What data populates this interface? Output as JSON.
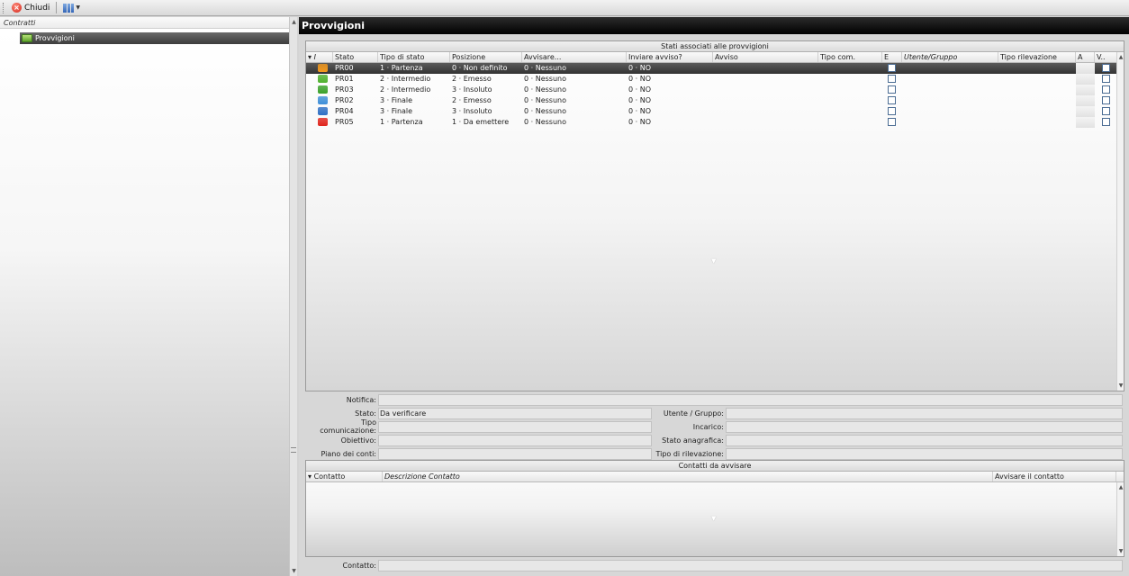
{
  "toolbar": {
    "close_label": "Chiudi"
  },
  "left": {
    "header": "Contratti",
    "tree_item": "Provvigioni"
  },
  "right": {
    "title": "Provvigioni"
  },
  "grid": {
    "title": "Stati associati alle provvigioni",
    "headers": {
      "indicator": "I",
      "stato": "Stato",
      "tipo_stato": "Tipo di stato",
      "posizione": "Posizione",
      "avvisare": "Avvisare...",
      "inviare": "Inviare avviso?",
      "avviso": "Avviso",
      "tipo_com": "Tipo com.",
      "e": "E",
      "utente": "Utente/Gruppo",
      "tipo_ril": "Tipo rilevazione",
      "a": "A",
      "v": "V.."
    },
    "rows": [
      {
        "color": "#f59a1e",
        "stato": "PR00",
        "tipo": "1 · Partenza",
        "posizione": "0 · Non definito",
        "avvisare": "0 · Nessuno",
        "inviare": "0 · NO"
      },
      {
        "color": "#4fb12e",
        "stato": "PR01",
        "tipo": "2 · Intermedio",
        "posizione": "2 · Emesso",
        "avvisare": "0 · Nessuno",
        "inviare": "0 · NO"
      },
      {
        "color": "#3aa12a",
        "stato": "PR03",
        "tipo": "2 · Intermedio",
        "posizione": "3 · Insoluto",
        "avvisare": "0 · Nessuno",
        "inviare": "0 · NO"
      },
      {
        "color": "#3f8fd8",
        "stato": "PR02",
        "tipo": "3 · Finale",
        "posizione": "2 · Emesso",
        "avvisare": "0 · Nessuno",
        "inviare": "0 · NO"
      },
      {
        "color": "#2f6fc4",
        "stato": "PR04",
        "tipo": "3 · Finale",
        "posizione": "3 · Insoluto",
        "avvisare": "0 · Nessuno",
        "inviare": "0 · NO"
      },
      {
        "color": "#e0251d",
        "stato": "PR05",
        "tipo": "1 · Partenza",
        "posizione": "1 · Da emettere",
        "avvisare": "0 · Nessuno",
        "inviare": "0 · NO"
      }
    ]
  },
  "form": {
    "notifica_label": "Notifica:",
    "notifica_value": "",
    "stato_label": "Stato:",
    "stato_value": "Da verificare",
    "tipo_com_label": "Tipo comunicazione:",
    "obiettivo_label": "Obiettivo:",
    "piano_label": "Piano dei conti:",
    "utente_label": "Utente / Gruppo:",
    "incarico_label": "Incarico:",
    "stato_anag_label": "Stato anagrafica:",
    "tipo_ril_label": "Tipo di rilevazione:"
  },
  "contacts": {
    "title": "Contatti da avvisare",
    "col_contatto": "Contatto",
    "col_descrizione": "Descrizione Contatto",
    "col_avvisare": "Avvisare il contatto",
    "bottom_label": "Contatto:"
  }
}
